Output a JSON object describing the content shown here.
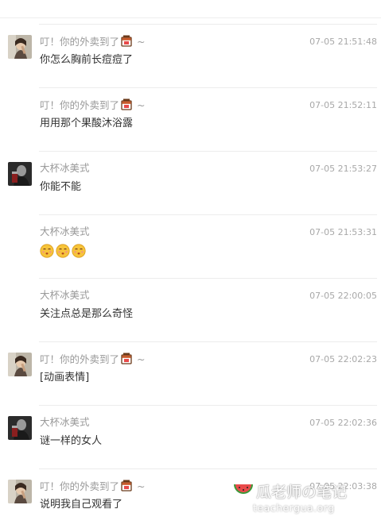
{
  "messages": [
    {
      "sender": "叮！你的外卖到了",
      "has_cup": true,
      "tilde": "~",
      "time": "07-05 21:51:48",
      "text": "你怎么胸前长痘痘了",
      "avatar": "photo-avatar"
    },
    {
      "sender": "叮！你的外卖到了",
      "has_cup": true,
      "tilde": "~",
      "time": "07-05 21:52:11",
      "text": "用用那个果酸沐浴露",
      "avatar": null
    },
    {
      "sender": "大杯冰美式",
      "has_cup": false,
      "tilde": "",
      "time": "07-05 21:53:27",
      "text": "你能不能",
      "avatar": "dark-avatar"
    },
    {
      "sender": "大杯冰美式",
      "has_cup": false,
      "tilde": "",
      "time": "07-05 21:53:31",
      "text": "",
      "emoji": [
        "kissing-face-icon",
        "kissing-face-icon",
        "kissing-face-icon"
      ],
      "avatar": null
    },
    {
      "sender": "大杯冰美式",
      "has_cup": false,
      "tilde": "",
      "time": "07-05 22:00:05",
      "text": "关注点总是那么奇怪",
      "avatar": null
    },
    {
      "sender": "叮！你的外卖到了",
      "has_cup": true,
      "tilde": "~",
      "time": "07-05 22:02:23",
      "text": "[动画表情]",
      "avatar": "photo-avatar"
    },
    {
      "sender": "大杯冰美式",
      "has_cup": false,
      "tilde": "",
      "time": "07-05 22:02:36",
      "text": "谜一样的女人",
      "avatar": "dark-avatar"
    },
    {
      "sender": "叮！你的外卖到了",
      "has_cup": true,
      "tilde": "~",
      "time": "07-05 22:03:38",
      "text": "说明我自己观看了",
      "avatar": "photo-avatar"
    }
  ],
  "watermark": {
    "title": "瓜老师の笔记",
    "url": "teachergua.org"
  }
}
